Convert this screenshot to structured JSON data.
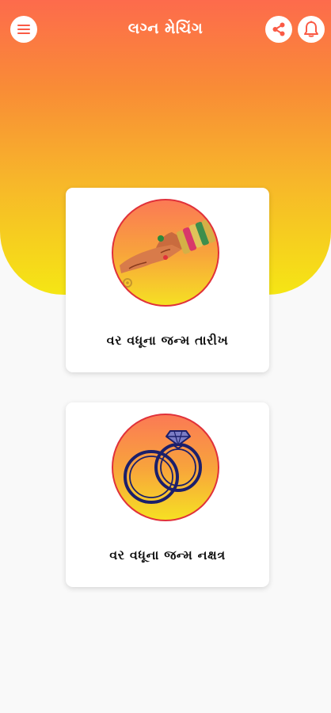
{
  "app": {
    "title": "લગ્ન મેચિંગ"
  },
  "colors": {
    "gradient_top": "#fd6b4c",
    "gradient_bottom": "#f5e614",
    "circle_border": "#e0313a",
    "ring_stroke": "#1b1f6b"
  },
  "header": {
    "menu_icon": "menu-icon",
    "share_icon": "share-icon",
    "bell_icon": "bell-icon"
  },
  "cards": [
    {
      "label": "વર વધૂના જન્મ તારીખ",
      "icon": "hands-with-bangles-image"
    },
    {
      "label": "વર વધૂના જન્મ નક્ષત્ર",
      "icon": "wedding-rings-icon"
    }
  ]
}
